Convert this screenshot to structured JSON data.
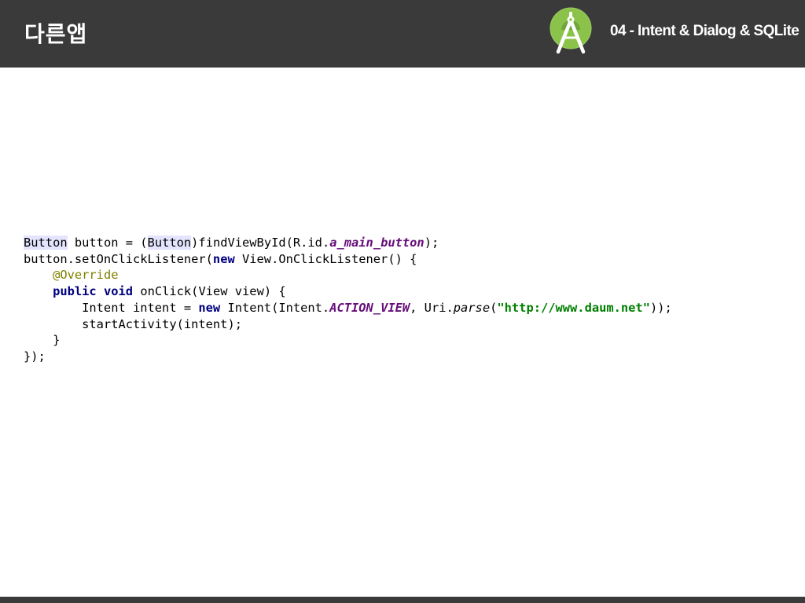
{
  "header": {
    "title": "다른앱",
    "subtitle": "04 - Intent & Dialog & SQLite",
    "logo_icon": "android-studio-icon"
  },
  "code": {
    "line1": {
      "t1": "Button",
      "t2": " button = (",
      "t3": "Button",
      "t4": ")findViewById(R.id.",
      "t5": "a_main_button",
      "t6": ");"
    },
    "line2": {
      "t1": "button.setOnClickListener(",
      "t2": "new",
      "t3": " View.OnClickListener() {"
    },
    "line3": {
      "t1": "    ",
      "t2": "@Override"
    },
    "line4": {
      "t1": "    ",
      "t2": "public",
      "t3": " ",
      "t4": "void",
      "t5": " onClick(View view) {"
    },
    "line5": {
      "t1": "        Intent intent = ",
      "t2": "new",
      "t3": " Intent(Intent.",
      "t4": "ACTION_VIEW",
      "t5": ", Uri.",
      "t6": "parse",
      "t7": "(",
      "t8": "\"http://www.daum.net\"",
      "t9": "));"
    },
    "line6": {
      "t1": "        startActivity(intent);"
    },
    "line7": {
      "t1": "    }"
    },
    "line8": {
      "t1": "});"
    }
  },
  "colors": {
    "header_bg": "#3a3a3a",
    "keyword": "#000080",
    "field": "#660e7a",
    "string": "#008000",
    "annotation": "#808000",
    "highlight": "#e4e4ff",
    "logo_green": "#8bc34a"
  }
}
